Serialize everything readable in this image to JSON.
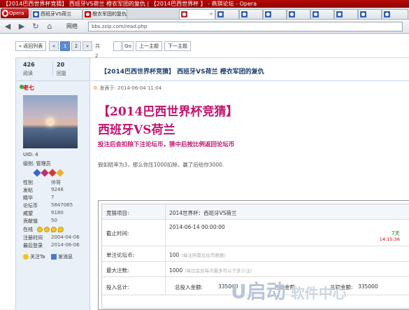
{
  "window": {
    "title": "【2014巴西世界杯竞猜】 西班牙VS荷兰 橙衣军团的复仇 | 【2014巴西世界杯 】 - 燕琪论坛 - Opera"
  },
  "browser": {
    "menu_label": "Opera",
    "tabs": [
      {
        "label": "西班牙VS荷兰"
      },
      {
        "label": "橙衣军团的复仇"
      },
      {
        "label": ""
      },
      {
        "label": ""
      },
      {
        "label": ""
      },
      {
        "label": ""
      },
      {
        "label": ""
      }
    ],
    "address_label": "网络",
    "url": "bbs.zzip.com/read.php"
  },
  "pager": {
    "back_label": "« 返回列表",
    "prev": "«",
    "page1": "1",
    "page2": "2",
    "next": "»",
    "total": "共2页",
    "go": "Go",
    "prev_topic": "上一主题",
    "next_topic": "下一主题"
  },
  "sidebar": {
    "views": "426",
    "views_label": "阅读",
    "replies": "20",
    "replies_label": "回复",
    "author": "老七",
    "uid_line": "UID: 4",
    "rank_line": "级别: 管理员",
    "stats": [
      {
        "label": "性别",
        "value": "帅哥"
      },
      {
        "label": "发帖",
        "value": "9246"
      },
      {
        "label": "精华",
        "value": "7"
      },
      {
        "label": "论坛币",
        "value": "5847065"
      },
      {
        "label": "威望",
        "value": "9180"
      },
      {
        "label": "贡献值",
        "value": "50"
      },
      {
        "label": "在线",
        "value": ""
      },
      {
        "label": "注册时间",
        "value": "2004-04-06"
      },
      {
        "label": "最后登录",
        "value": "2014-06-06"
      }
    ],
    "follow": "关注Ta",
    "message": "发消息"
  },
  "post": {
    "thread_title": "【2014巴西世界杯竞猜】 西班牙VS荷兰    橙衣军团的复仇",
    "floor": "0",
    "posted_at": "发表于: 2014-06-04 11:04",
    "headline": "【2014巴西世界杯竞猜】",
    "match": "西班牙VS荷兰",
    "note": "投注后会扣除下注论坛币，猜中后按比例返回论坛币",
    "desc": "假如赔率为3，那么你压1000扣除，赢了后给你3000.",
    "table": {
      "item_label": "竞猜项目:",
      "item_value": "2014世界杯：西班牙VS荷兰",
      "deadline_label": "截止时间:",
      "deadline_value": "2014-06-14 00:00:00",
      "remaining_days": "7天",
      "remaining_clock": "14:15:36",
      "unit_label": "单注论坛币:",
      "unit_value": "100",
      "unit_hint": "(每注所需论坛币数额)",
      "max_label": "最大注数:",
      "max_value": "1000",
      "max_hint": "(每位会员每次最多可以下多少注)",
      "total_label": "投入总计:",
      "total_amount_label": "总投入金额:",
      "total_amount": "335000",
      "win_label": "总赢金额:",
      "lose_label": "总输金额:",
      "lose_amount": "335000"
    }
  },
  "watermark": {
    "brand": "U启动",
    "suffix": "软件中心"
  }
}
